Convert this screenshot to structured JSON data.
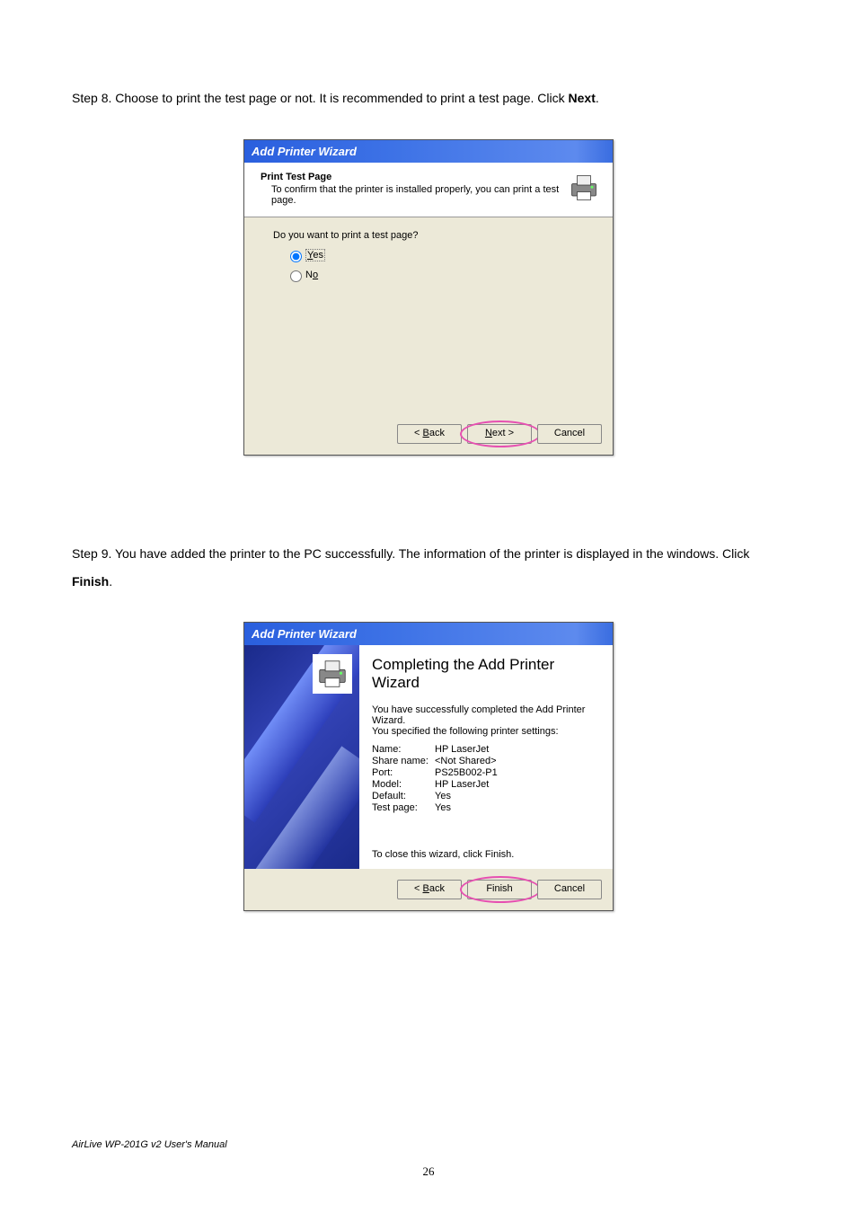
{
  "step8": {
    "text_a": "Step 8. Choose to print the test page or not. It is recommended to print a test page. Click ",
    "text_b": "Next",
    "text_c": "."
  },
  "dialog1": {
    "title": "Add Printer Wizard",
    "heading": "Print Test Page",
    "sub": "To confirm that the printer is installed properly, you can print a test page.",
    "prompt": "Do you want to print a test page?",
    "opt_yes": "Yes",
    "opt_no": "No",
    "back": "< Back",
    "next": "Next >",
    "cancel": "Cancel"
  },
  "step9": {
    "text_a": "Step 9. You have added the printer to the PC successfully. The information of the printer is displayed in the windows. Click ",
    "text_b": "Finish",
    "text_c": "."
  },
  "dialog2": {
    "title": "Add Printer Wizard",
    "heading": "Completing the Add Printer Wizard",
    "line1": "You have successfully completed the Add Printer Wizard.",
    "line2": "You specified the following printer settings:",
    "rows": {
      "name_k": "Name:",
      "name_v": "HP LaserJet",
      "share_k": "Share name:",
      "share_v": "<Not Shared>",
      "port_k": "Port:",
      "port_v": "PS25B002-P1",
      "model_k": "Model:",
      "model_v": "HP LaserJet",
      "default_k": "Default:",
      "default_v": "Yes",
      "test_k": "Test page:",
      "test_v": "Yes"
    },
    "close_hint": "To close this wizard, click Finish.",
    "back": "< Back",
    "finish": "Finish",
    "cancel": "Cancel"
  },
  "footer": "AirLive WP-201G v2 User's Manual",
  "page_number": "26"
}
